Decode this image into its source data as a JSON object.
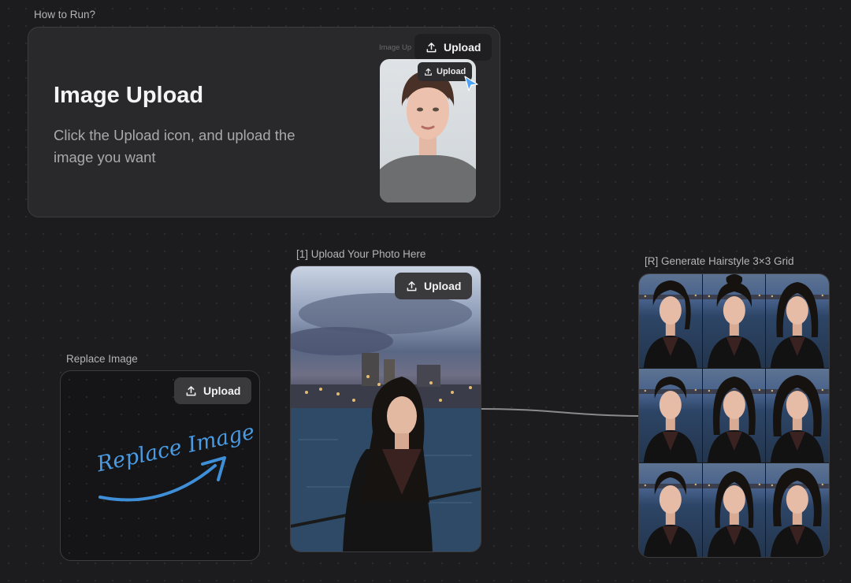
{
  "how_to_run": {
    "label": "How to Run?",
    "title": "Image Upload",
    "description": "Click the Upload icon, and upload the  image you want",
    "mini_hint": "Image Up",
    "upload_label": "Upload",
    "mini_upload_label": "Upload"
  },
  "replace_node": {
    "label": "Replace Image",
    "upload_label": "Upload",
    "handwritten_text": "Replace Image",
    "accent_color": "#3f8fd8"
  },
  "upload_node": {
    "label": "[1] Upload Your Photo Here",
    "upload_label": "Upload"
  },
  "result_node": {
    "label": "[R] Generate Hairstyle 3×3 Grid",
    "grid_size": "3×3"
  },
  "icons": {
    "upload": "upload-icon",
    "cursor": "cursor-icon",
    "arrow": "arrow-icon"
  },
  "colors": {
    "canvas": "#1c1c1e",
    "card": "#262628",
    "button": "#3a3a3d",
    "cursor_accent": "#4ea3f5"
  }
}
